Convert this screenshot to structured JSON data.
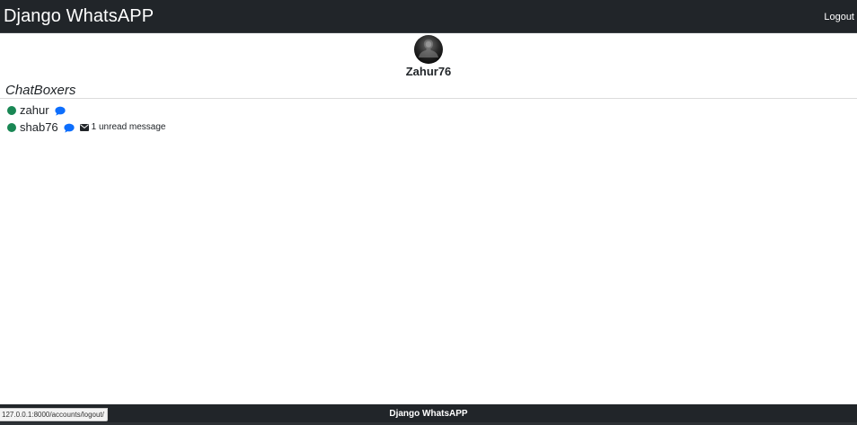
{
  "navbar": {
    "brand": "Django WhatsAPP",
    "logout": "Logout"
  },
  "profile": {
    "username": "Zahur76"
  },
  "section": {
    "title": "ChatBoxers"
  },
  "contacts": [
    {
      "name": "zahur",
      "status": "online",
      "unread_text": ""
    },
    {
      "name": "shab76",
      "status": "online",
      "unread_text": "1 unread message"
    }
  ],
  "footer": {
    "text": "Django WhatsAPP"
  },
  "browser": {
    "status_url": "127.0.0.1:8000/accounts/logout/"
  },
  "colors": {
    "navbar_bg": "#212529",
    "online": "#198754",
    "chat_icon": "#0d6efd"
  },
  "icons": {
    "status": "status-dot",
    "chat": "chat-icon",
    "mail": "envelope-icon"
  }
}
